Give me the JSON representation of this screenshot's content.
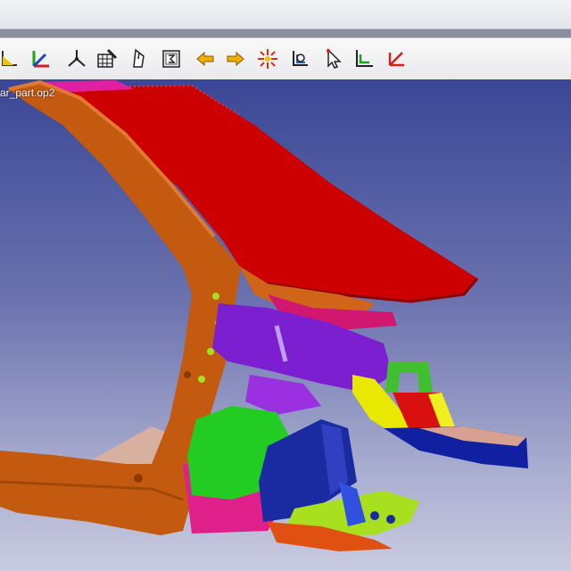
{
  "viewport": {
    "file_label": "ar_part.op2"
  },
  "toolbar": {
    "tools": [
      {
        "icon": "axis-yellow-icon"
      },
      {
        "icon": "axis-color-icon"
      },
      {
        "icon": "triad-icon"
      },
      {
        "icon": "mesh-pencil-icon"
      },
      {
        "icon": "mouse-icon"
      },
      {
        "icon": "sum-icon"
      },
      {
        "icon": "arrow-left-icon"
      },
      {
        "icon": "arrow-right-icon"
      },
      {
        "icon": "starburst-icon"
      },
      {
        "icon": "probe-icon"
      },
      {
        "icon": "pointer-icon"
      },
      {
        "icon": "axis-green-icon"
      },
      {
        "icon": "axis-red-icon"
      }
    ]
  },
  "colors": {
    "roof": "#cc0000",
    "pillar": "#c45a10",
    "panel_purple": "#7b1fd0",
    "panel_green": "#22cc22",
    "bracket_yellow": "#e8e800",
    "panel_blue": "#1a2aa0",
    "accent_magenta": "#e0208a",
    "lime": "#a8e020"
  }
}
